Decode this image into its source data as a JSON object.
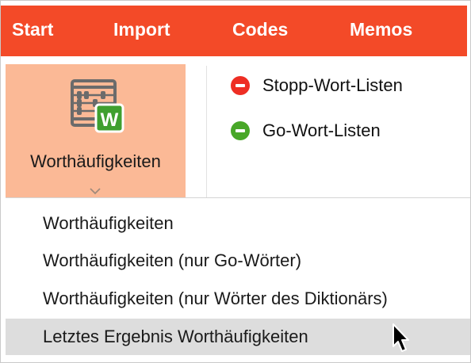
{
  "menubar": {
    "items": [
      {
        "label": "Start"
      },
      {
        "label": "Import"
      },
      {
        "label": "Codes"
      },
      {
        "label": "Memos"
      }
    ]
  },
  "ribbon": {
    "big_button": {
      "label": "Worthäufigkeiten",
      "icon": "abacus-icon",
      "badge": "W",
      "badge_color": "#3f9f2f"
    },
    "lists": [
      {
        "label": "Stopp-Wort-Listen",
        "icon": "minus-circle-red-icon",
        "color": "#ee2e24"
      },
      {
        "label": "Go-Wort-Listen",
        "icon": "minus-circle-green-icon",
        "color": "#48a728"
      }
    ]
  },
  "dropdown": {
    "items": [
      {
        "label": "Worthäufigkeiten"
      },
      {
        "label": "Worthäufigkeiten (nur Go-Wörter)"
      },
      {
        "label": "Worthäufigkeiten (nur Wörter des Diktionärs)"
      },
      {
        "label": "Letztes Ergebnis Worthäufigkeiten",
        "highlighted": true
      }
    ]
  },
  "colors": {
    "menubar_bg": "#f34a28",
    "ribbon_selected_bg": "#fbb996",
    "menu_highlight": "#dddddd"
  }
}
